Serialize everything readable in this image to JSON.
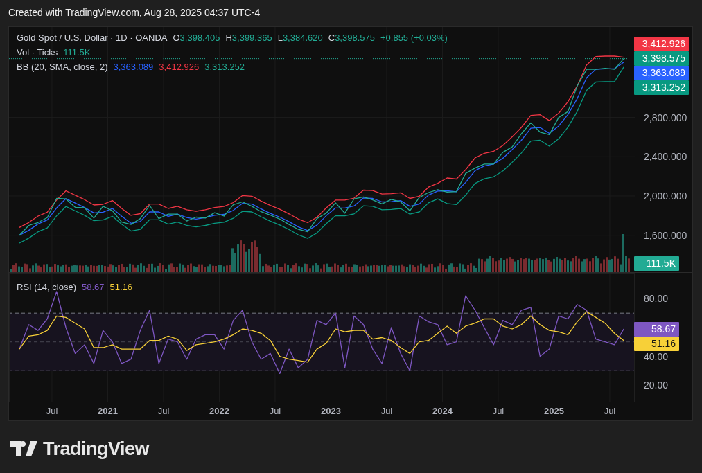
{
  "header": {
    "text": "Created with TradingView.com, Aug 28, 2025 04:37 UTC-4"
  },
  "price_pane": {
    "legend": {
      "symbol": "Gold Spot / U.S. Dollar · 1D · OANDA",
      "ohlc": [
        {
          "key": "O",
          "value": "3,398.405"
        },
        {
          "key": "H",
          "value": "3,399.365"
        },
        {
          "key": "L",
          "value": "3,384.620"
        },
        {
          "key": "C",
          "value": "3,398.575"
        }
      ],
      "change": "+0.855 (+0.03%)"
    },
    "volume_legend": {
      "label": "Vol · Ticks",
      "value": "111.5K"
    },
    "bb_legend": {
      "label": "BB (20, SMA, close, 2)",
      "values": [
        {
          "text": "3,363.089",
          "color": "#2962ff"
        },
        {
          "text": "3,412.926",
          "color": "#f23645"
        },
        {
          "text": "3,313.252",
          "color": "#22ab94"
        }
      ]
    },
    "axis_badges": [
      {
        "text": "3,412.926",
        "color": "#f23645"
      },
      {
        "text": "3,398.575",
        "color": "#089981"
      },
      {
        "text": "3,363.089",
        "color": "#2962ff"
      },
      {
        "text": "3,313.252",
        "color": "#089981"
      }
    ],
    "volume_badge": {
      "text": "111.5K",
      "color": "#22ab94"
    },
    "chart_data": {
      "type": "line",
      "grid": true,
      "series": [
        {
          "color": "#f23645",
          "values": [
            1680,
            1730,
            1795,
            1835,
            1958,
            2053,
            2008,
            1963,
            1908,
            1915,
            1953,
            1873,
            1803,
            1820,
            1918,
            1918,
            1873,
            1895,
            1860,
            1845,
            1860,
            1883,
            1893,
            1933,
            2005,
            1998,
            1948,
            1903,
            1865,
            1818,
            1765,
            1728,
            1783,
            1878,
            1958,
            1958,
            1978,
            2060,
            2055,
            2020,
            2023,
            2033,
            1975,
            1998,
            2090,
            2130,
            2183,
            2173,
            2268,
            2388,
            2435,
            2455,
            2515,
            2603,
            2698,
            2820,
            2828,
            2768,
            2843,
            2960,
            3120,
            3335,
            3420,
            3425,
            3425,
            3413
          ]
        },
        {
          "color": "#089981",
          "values": [
            1520,
            1570,
            1635,
            1675,
            1798,
            1893,
            1848,
            1803,
            1748,
            1755,
            1793,
            1713,
            1643,
            1660,
            1758,
            1758,
            1713,
            1735,
            1700,
            1685,
            1700,
            1723,
            1733,
            1773,
            1845,
            1838,
            1788,
            1743,
            1705,
            1658,
            1605,
            1568,
            1623,
            1718,
            1798,
            1798,
            1818,
            1900,
            1895,
            1860,
            1863,
            1873,
            1815,
            1838,
            1930,
            1970,
            1923,
            1913,
            2008,
            2128,
            2175,
            2195,
            2255,
            2343,
            2438,
            2560,
            2568,
            2508,
            2583,
            2700,
            2860,
            3075,
            3160,
            3165,
            3165,
            3313
          ]
        },
        {
          "color": "#2962ff",
          "values": [
            1600,
            1650,
            1715,
            1755,
            1878,
            1973,
            1928,
            1883,
            1828,
            1835,
            1873,
            1793,
            1723,
            1740,
            1838,
            1838,
            1793,
            1815,
            1780,
            1765,
            1780,
            1803,
            1813,
            1853,
            1925,
            1918,
            1868,
            1823,
            1785,
            1738,
            1685,
            1648,
            1703,
            1798,
            1878,
            1878,
            1898,
            1980,
            1975,
            1940,
            1943,
            1953,
            1895,
            1918,
            2010,
            2050,
            2053,
            2043,
            2138,
            2258,
            2305,
            2325,
            2385,
            2473,
            2568,
            2690,
            2698,
            2638,
            2713,
            2830,
            2990,
            3205,
            3290,
            3295,
            3295,
            3363
          ]
        },
        {
          "color": "#22ab94",
          "values": [
            1600,
            1700,
            1730,
            1780,
            1975,
            1970,
            1885,
            1880,
            1775,
            1895,
            1850,
            1735,
            1710,
            1770,
            1905,
            1770,
            1815,
            1815,
            1745,
            1785,
            1775,
            1830,
            1795,
            1910,
            1940,
            1895,
            1840,
            1805,
            1765,
            1710,
            1660,
            1635,
            1770,
            1825,
            1930,
            1825,
            1970,
            1990,
            1960,
            1920,
            1965,
            1940,
            1850,
            1985,
            2035,
            2065,
            2040,
            2045,
            2230,
            2285,
            2325,
            2325,
            2445,
            2500,
            2635,
            2745,
            2650,
            2625,
            2800,
            2860,
            3120,
            3290,
            3290,
            3300,
            3290,
            3399
          ]
        }
      ],
      "ylim": [
        1224,
        3721
      ],
      "yticks": [
        {
          "value": 1600,
          "label": "1,600.000"
        },
        {
          "value": 2000,
          "label": "2,000.000"
        },
        {
          "value": 2400,
          "label": "2,400.000"
        },
        {
          "value": 2800,
          "label": "2,800.000"
        }
      ]
    }
  },
  "rsi_pane": {
    "legend": {
      "label": "RSI (14, close)",
      "values": [
        {
          "text": "58.67",
          "color": "#7e57c2"
        },
        {
          "text": "51.16",
          "color": "#f7d038"
        }
      ]
    },
    "axis_badges": [
      {
        "text": "58.67",
        "color": "#7e57c2"
      },
      {
        "text": "51.16",
        "color": "#f7d038"
      }
    ],
    "chart_data": {
      "type": "line",
      "grid": true,
      "x": [
        2020.208,
        2020.292,
        2020.375,
        2020.458,
        2020.542,
        2020.625,
        2020.708,
        2020.792,
        2020.875,
        2020.958,
        2021.042,
        2021.125,
        2021.208,
        2021.292,
        2021.375,
        2021.458,
        2021.542,
        2021.625,
        2021.708,
        2021.792,
        2021.875,
        2021.958,
        2022.042,
        2022.125,
        2022.208,
        2022.292,
        2022.375,
        2022.458,
        2022.542,
        2022.625,
        2022.708,
        2022.792,
        2022.875,
        2022.958,
        2023.042,
        2023.125,
        2023.208,
        2023.292,
        2023.375,
        2023.458,
        2023.542,
        2023.625,
        2023.708,
        2023.792,
        2023.875,
        2023.958,
        2024.042,
        2024.125,
        2024.208,
        2024.292,
        2024.375,
        2024.458,
        2024.542,
        2024.625,
        2024.708,
        2024.792,
        2024.875,
        2024.958,
        2025.042,
        2025.125,
        2025.208,
        2025.292,
        2025.375,
        2025.458,
        2025.542,
        2025.625
      ],
      "series": [
        {
          "color": "#7e57c2",
          "values": [
            45,
            62,
            58,
            66,
            85,
            60,
            42,
            48,
            35,
            58,
            50,
            35,
            38,
            58,
            72,
            35,
            52,
            50,
            38,
            52,
            55,
            55,
            45,
            65,
            72,
            50,
            38,
            42,
            28,
            45,
            32,
            38,
            65,
            62,
            70,
            32,
            68,
            62,
            45,
            35,
            60,
            42,
            30,
            68,
            64,
            62,
            48,
            50,
            82,
            72,
            60,
            48,
            65,
            62,
            72,
            74,
            40,
            45,
            68,
            66,
            76,
            72,
            52,
            50,
            48,
            59
          ]
        },
        {
          "color": "#f7d038",
          "values": [
            45,
            54,
            55,
            58,
            68,
            67,
            63,
            59,
            46,
            46,
            48,
            45,
            45,
            45,
            51,
            51,
            54,
            52,
            44,
            48,
            49,
            50,
            52,
            55,
            59,
            58,
            56,
            51,
            40,
            38,
            37,
            36,
            45,
            49,
            59,
            57,
            58,
            58,
            52,
            53,
            51,
            46,
            42,
            50,
            51,
            56,
            61,
            56,
            61,
            63,
            66,
            66,
            61,
            59,
            62,
            68,
            62,
            58,
            57,
            55,
            64,
            71,
            67,
            63,
            56,
            51
          ]
        }
      ],
      "xlim": [
        2020.115,
        2025.724
      ],
      "ylim": [
        8,
        98
      ],
      "xticks": [
        {
          "value": 2020.5,
          "label": "Jul"
        },
        {
          "value": 2021,
          "label": "2021"
        },
        {
          "value": 2021.5,
          "label": "Jul"
        },
        {
          "value": 2022,
          "label": "2022"
        },
        {
          "value": 2022.5,
          "label": "Jul"
        },
        {
          "value": 2023,
          "label": "2023"
        },
        {
          "value": 2023.5,
          "label": "Jul"
        },
        {
          "value": 2024,
          "label": "2024"
        },
        {
          "value": 2024.5,
          "label": "Jul"
        },
        {
          "value": 2025,
          "label": "2025"
        },
        {
          "value": 2025.5,
          "label": "Jul"
        }
      ],
      "yticks": [
        {
          "value": 20,
          "label": "20.00"
        },
        {
          "value": 40,
          "label": "40.00"
        },
        {
          "value": 80,
          "label": "80.00"
        }
      ]
    }
  },
  "footer": {
    "brand": "TradingView"
  }
}
